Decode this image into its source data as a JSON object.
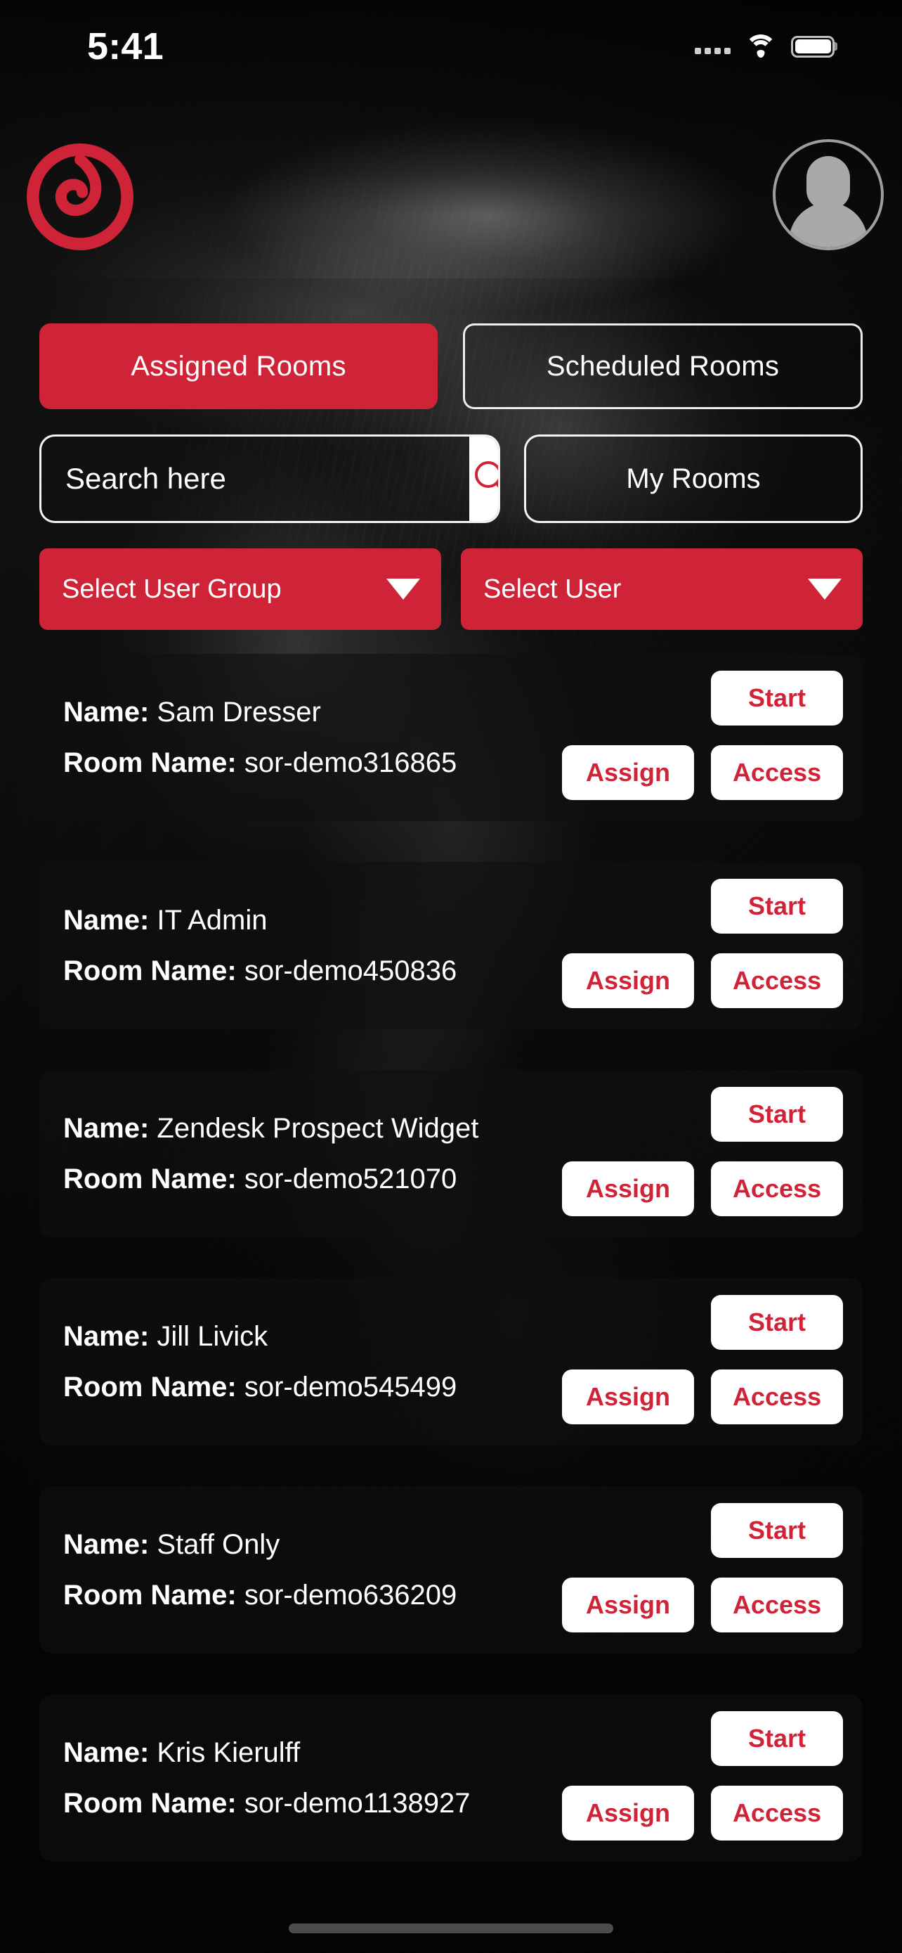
{
  "colors": {
    "accent_red": "#CF2437",
    "card_bg": "#101010",
    "white": "#FFFFFF"
  },
  "status_bar": {
    "time": "5:41",
    "signal_icon": "signal-dots-icon",
    "wifi_icon": "wifi-icon",
    "battery_icon": "battery-full-icon"
  },
  "header": {
    "logo_icon": "brand-spiral-logo-icon",
    "avatar_icon": "user-avatar-placeholder-icon"
  },
  "tabs": [
    {
      "label": "Assigned Rooms",
      "active": true
    },
    {
      "label": "Scheduled Rooms",
      "active": false
    }
  ],
  "search": {
    "placeholder": "Search here",
    "value": "",
    "button_icon": "search-icon"
  },
  "my_rooms_button": {
    "label": "My Rooms"
  },
  "filters": [
    {
      "label": "Select User Group",
      "caret_icon": "chevron-down-icon"
    },
    {
      "label": "Select User",
      "caret_icon": "chevron-down-icon"
    }
  ],
  "labels": {
    "name": "Name:",
    "room_name": "Room Name:",
    "start": "Start",
    "assign": "Assign",
    "access": "Access"
  },
  "rooms": [
    {
      "name": "Sam Dresser",
      "room_name": "sor-demo316865"
    },
    {
      "name": "IT Admin",
      "room_name": "sor-demo450836"
    },
    {
      "name": "Zendesk Prospect Widget",
      "room_name": "sor-demo521070"
    },
    {
      "name": "Jill Livick",
      "room_name": "sor-demo545499"
    },
    {
      "name": "Staff Only",
      "room_name": "sor-demo636209"
    },
    {
      "name": "Kris Kierulff",
      "room_name": "sor-demo1138927"
    }
  ]
}
